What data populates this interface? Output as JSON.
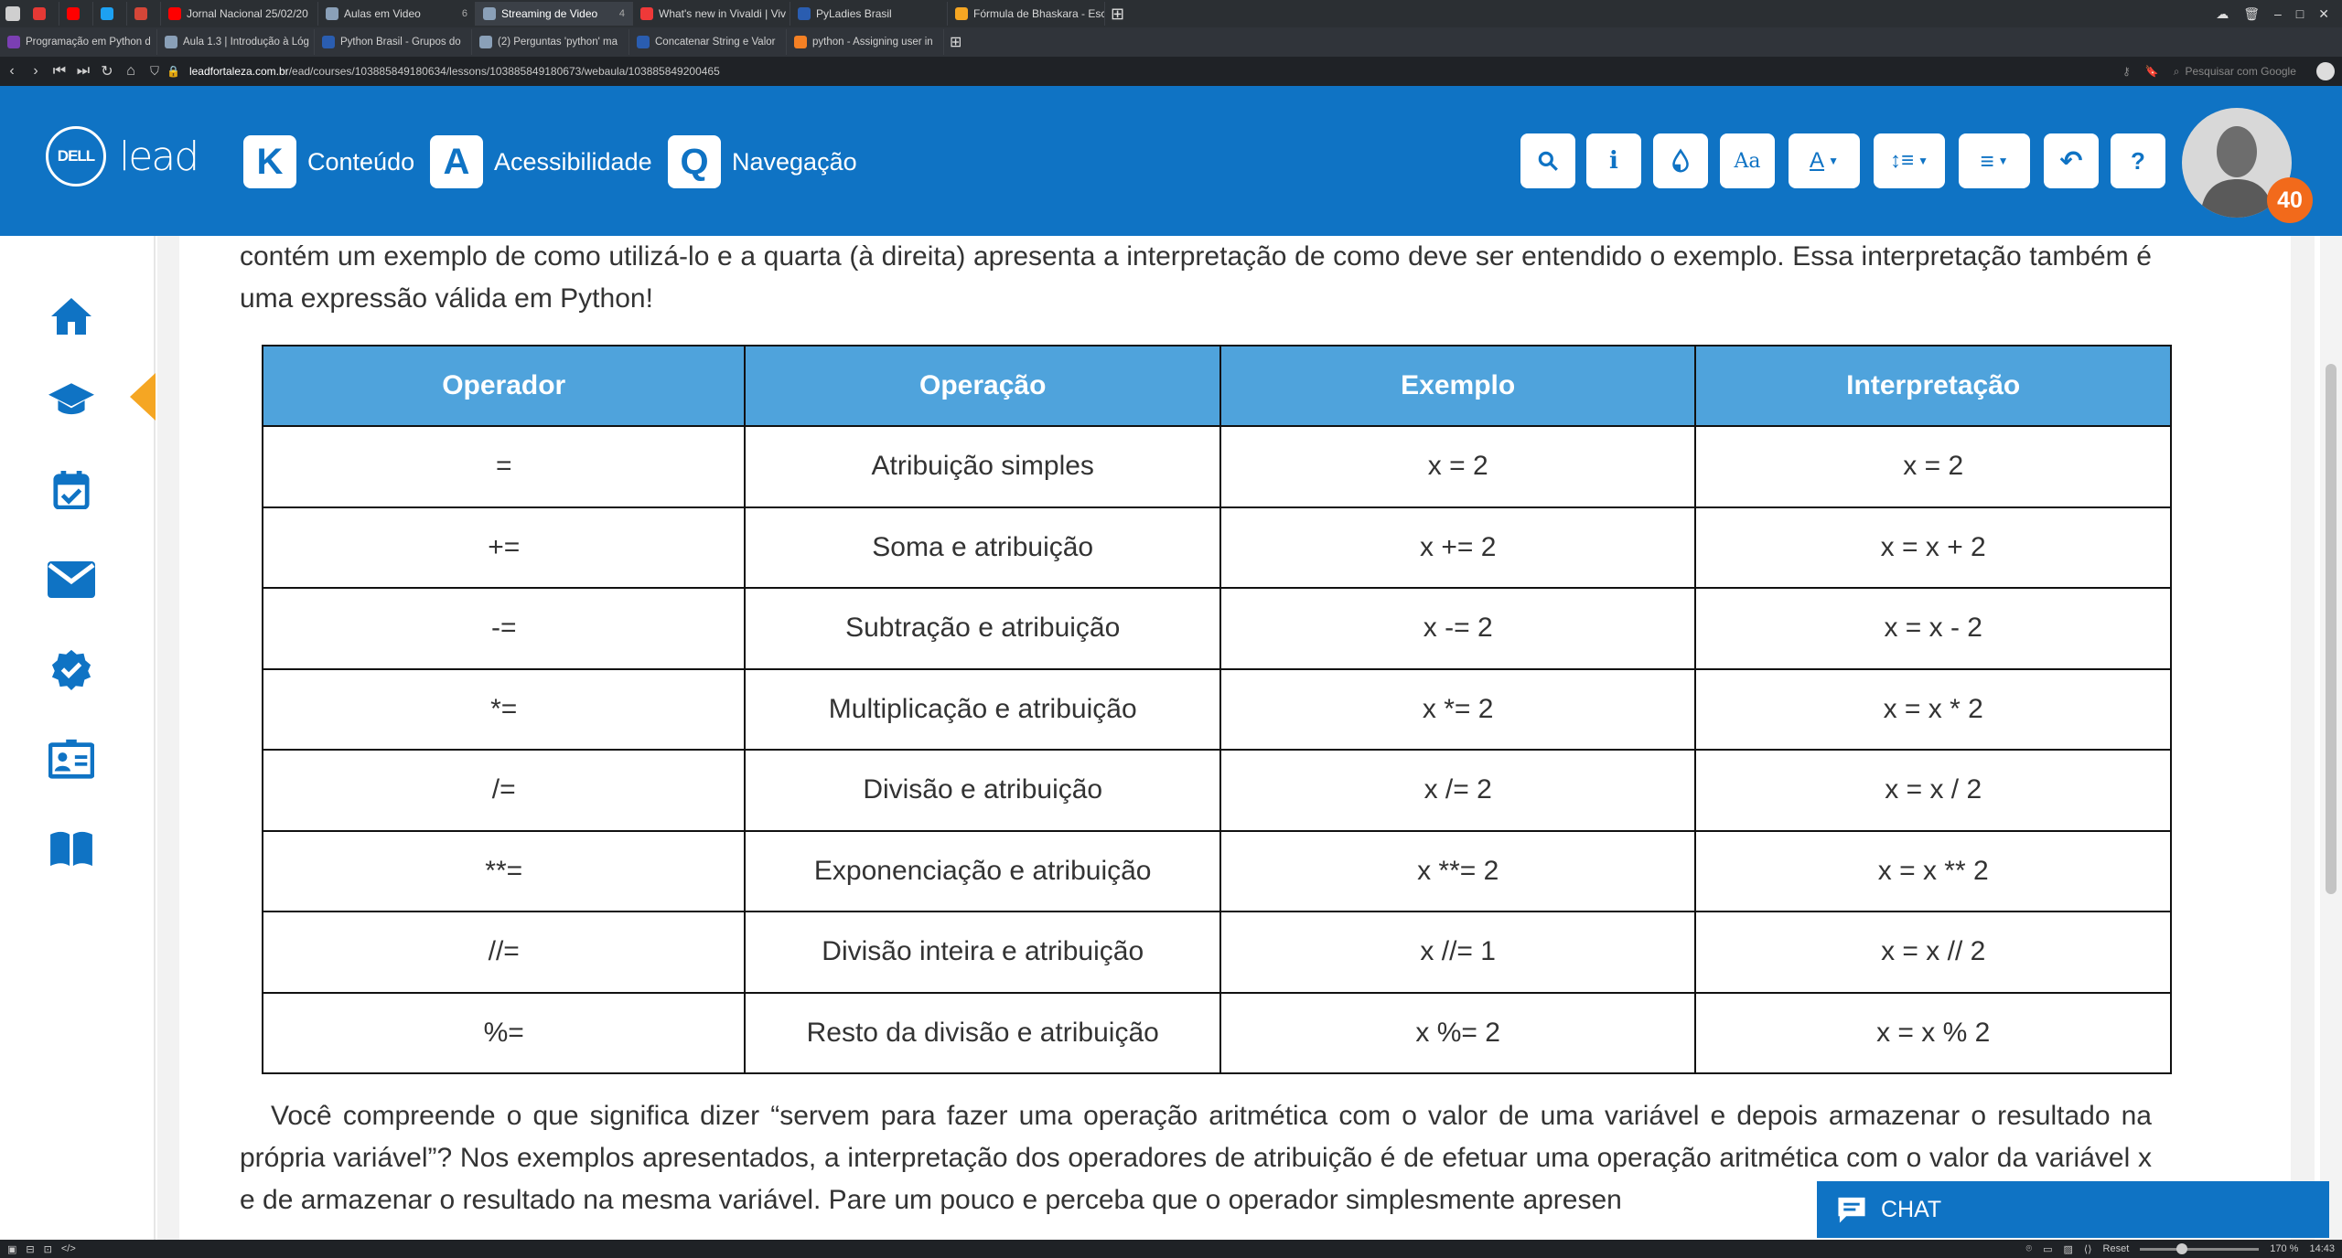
{
  "browser": {
    "tabs": [
      {
        "label": "",
        "color": "#e53935"
      },
      {
        "label": "",
        "color": "#ff0000"
      },
      {
        "label": "",
        "color": "#1da1f2"
      },
      {
        "label": "",
        "color": "#d44638"
      },
      {
        "label": "Jornal Nacional 25/02/20",
        "color": "#ff0000"
      },
      {
        "label": "Aulas em Video",
        "count": "6",
        "color": "#8aa0b8"
      },
      {
        "label": "Streaming de Video",
        "count": "4",
        "color": "#8aa0b8",
        "active": true
      },
      {
        "label": "What's new in Vivaldi | Viv",
        "color": "#ef3939"
      },
      {
        "label": "PyLadies Brasil",
        "color": "#2a5db0"
      },
      {
        "label": "Fórmula de Bhaskara - Esc",
        "color": "#f5a623"
      }
    ],
    "bookmarks": [
      "Programação em Python d",
      "Aula 1.3 | Introdução à Lóg",
      "Python Brasil - Grupos do",
      "(2) Perguntas 'python' ma",
      "Concatenar String e Valor",
      "python - Assigning user in"
    ],
    "url_host": "leadfortaleza.com.br",
    "url_path": "/ead/courses/103885849180634/lessons/103885849180673/webaula/103885849200465",
    "search_placeholder": "Pesquisar com Google",
    "zoom": "170 %",
    "reset_label": "Reset",
    "clock": "14:43"
  },
  "header": {
    "dell_logo": "DELL",
    "lead_logo": "lead",
    "menu": [
      {
        "key": "K",
        "label": "Conteúdo"
      },
      {
        "key": "A",
        "label": "Acessibilidade"
      },
      {
        "key": "Q",
        "label": "Navegação"
      }
    ],
    "tools": {
      "font_label": "Aa",
      "help_label": "?",
      "info_label": "i"
    },
    "badge_count": "40"
  },
  "content": {
    "paragraph_top": "contém um exemplo de como utilizá-lo e a quarta (à direita) apresenta a interpretação de como deve ser entendido o exemplo. Essa interpretação também é uma expressão válida em Python!",
    "table": {
      "headers": [
        "Operador",
        "Operação",
        "Exemplo",
        "Interpretação"
      ],
      "rows": [
        [
          "=",
          "Atribuição simples",
          "x = 2",
          "x = 2"
        ],
        [
          "+=",
          "Soma e atribuição",
          "x += 2",
          "x = x + 2"
        ],
        [
          "-=",
          "Subtração e atribuição",
          "x -= 2",
          "x = x - 2"
        ],
        [
          "*=",
          "Multiplicação e atribuição",
          "x *= 2",
          "x = x * 2"
        ],
        [
          "/=",
          "Divisão e atribuição",
          "x /= 2",
          "x = x / 2"
        ],
        [
          "**=",
          "Exponenciação e atribuição",
          "x **= 2",
          "x = x ** 2"
        ],
        [
          "//=",
          "Divisão inteira e atribuição",
          "x //= 1",
          "x = x // 2"
        ],
        [
          "%=",
          "Resto da divisão e atribuição",
          "x %= 2",
          "x = x % 2"
        ]
      ]
    },
    "paragraph_bottom": "Você compreende o que significa dizer “servem para fazer uma operação aritmética com o valor de uma variável e depois armazenar o resultado na própria variável”? Nos exemplos apresentados, a interpretação dos operadores de atribuição é de efetuar uma operação aritmética com o valor da variável x e de armazenar o resultado na mesma variável. Pare um pouco e perceba que o operador simplesmente apresen"
  },
  "chat": {
    "label": "CHAT"
  },
  "colors": {
    "brand_blue": "#0f73c4",
    "table_header": "#4fa3dc",
    "accent_orange": "#f26a1b",
    "sidebar_arrow": "#f5a623"
  }
}
